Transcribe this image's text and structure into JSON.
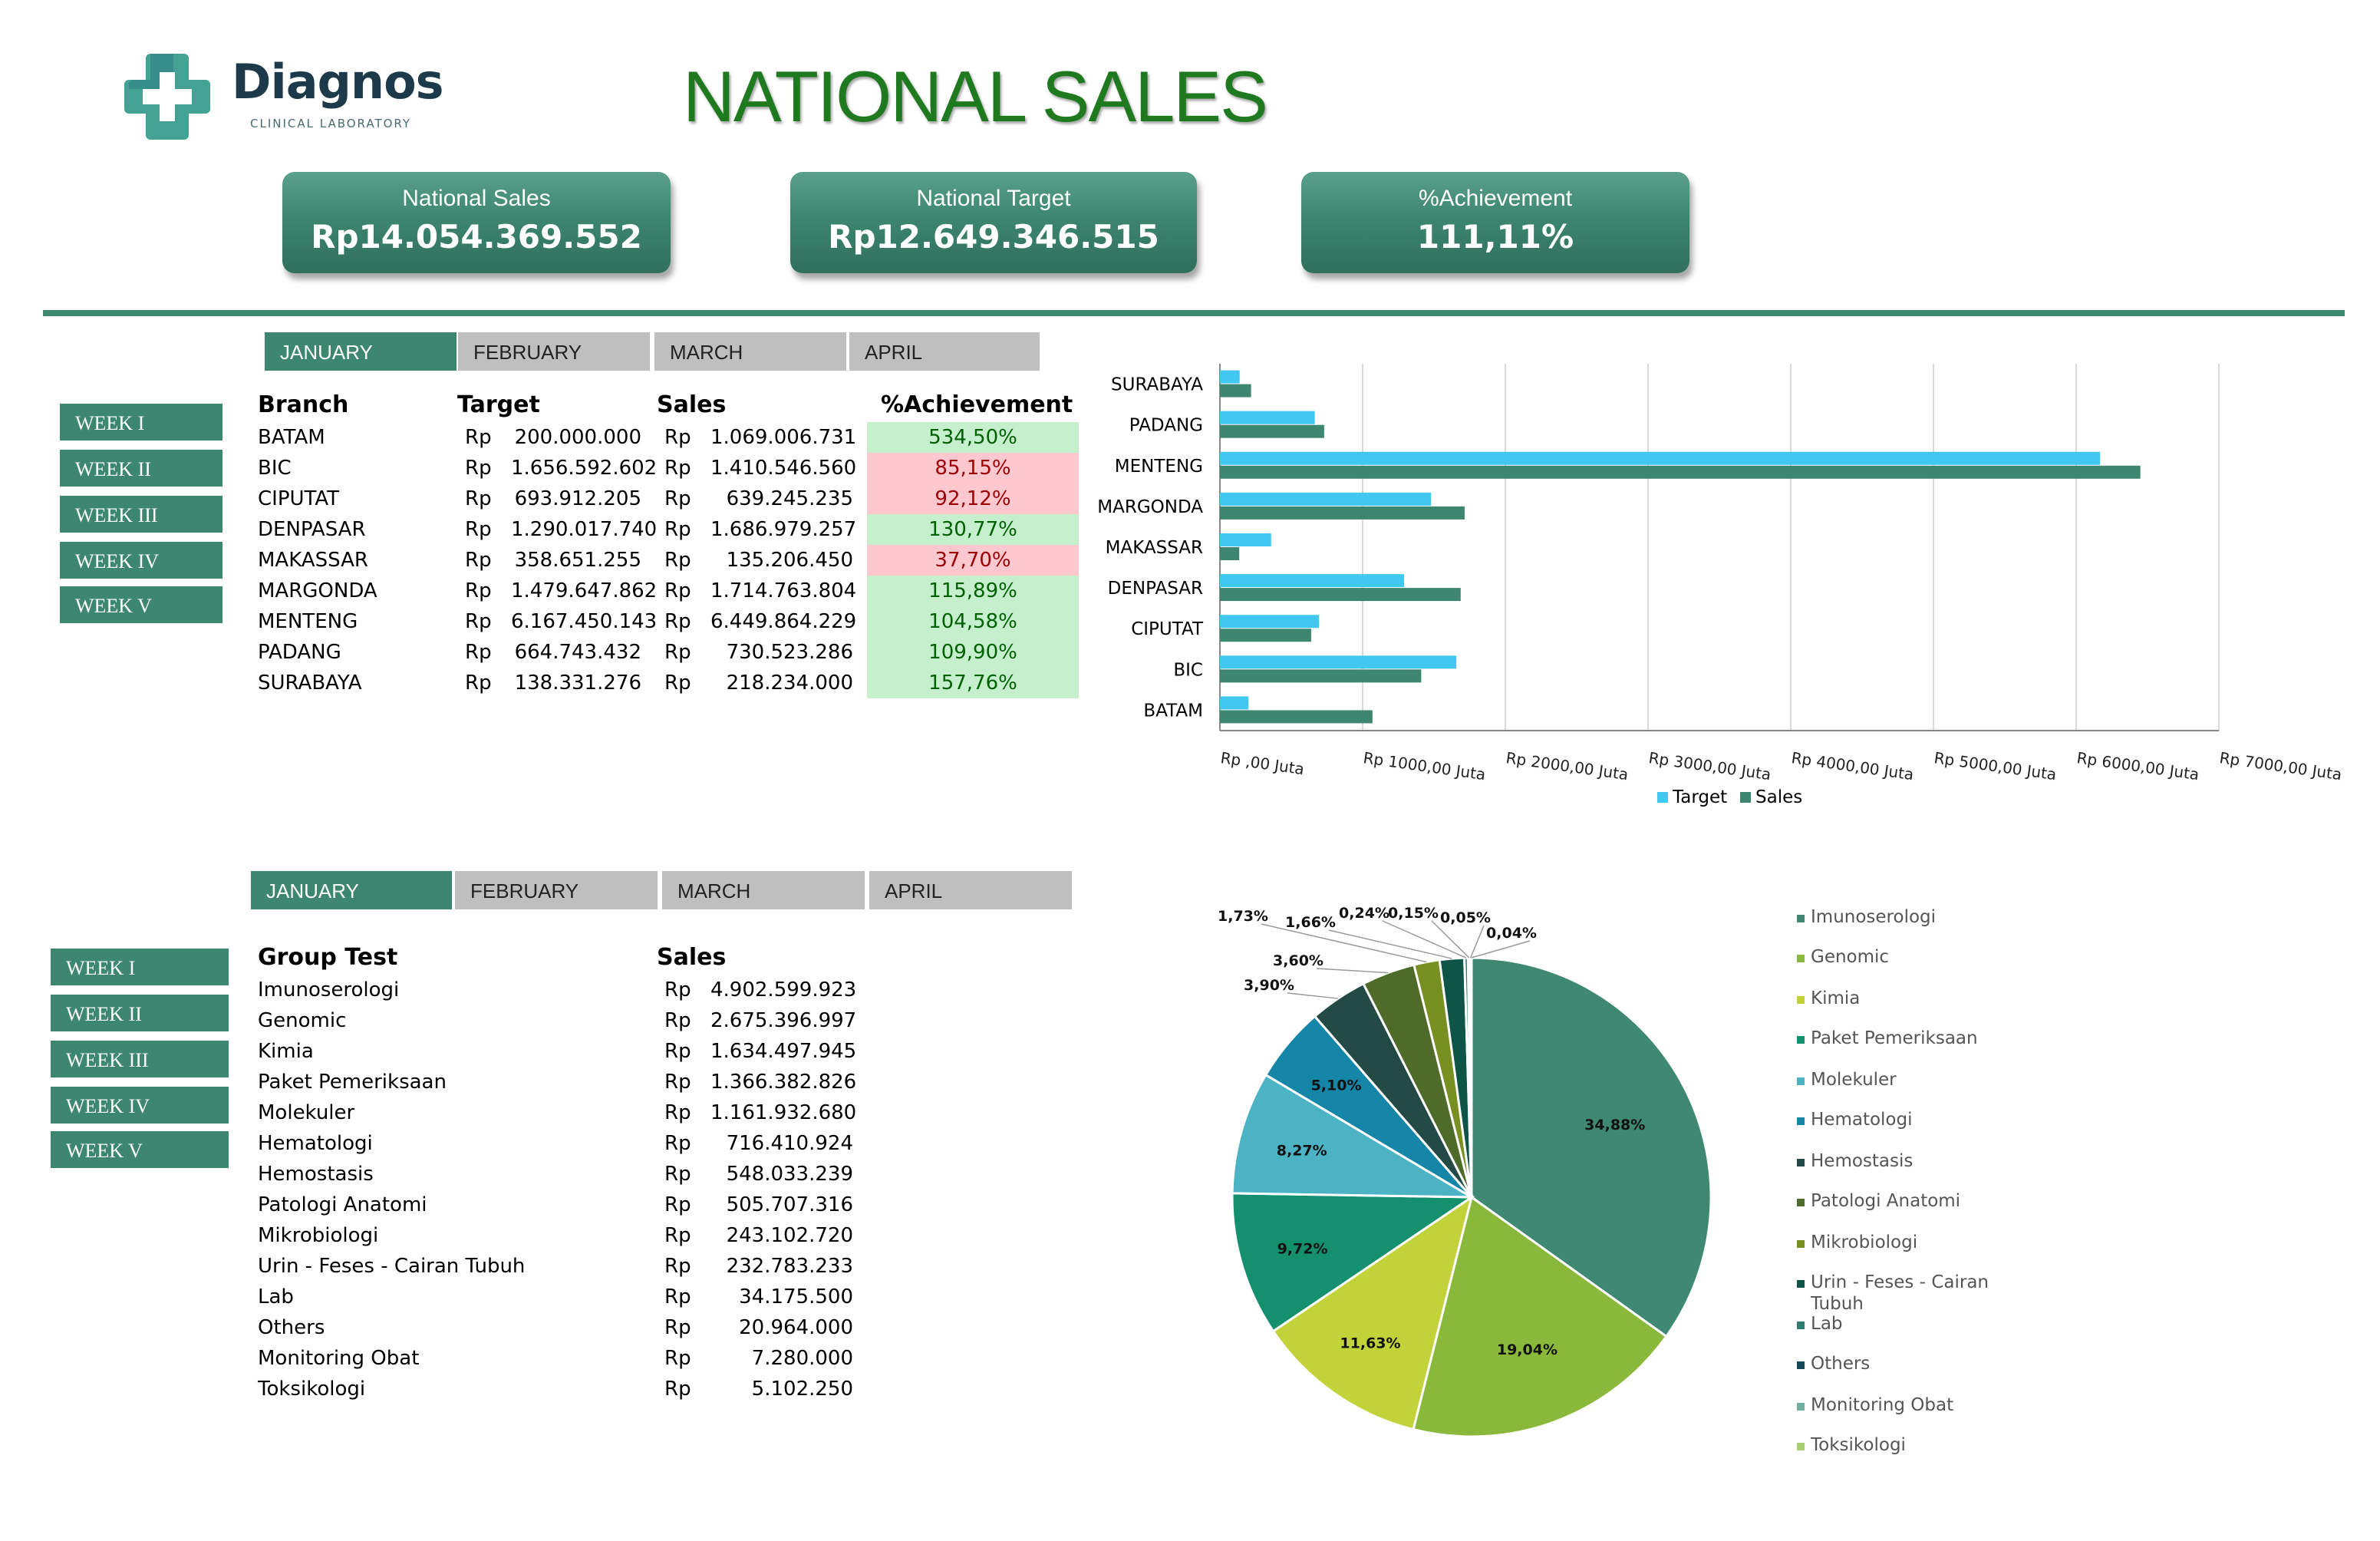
{
  "brand": {
    "name": "Diagnos",
    "subtitle": "CLINICAL LABORATORY"
  },
  "page_title": "NATIONAL SALES",
  "kpis": [
    {
      "label": "National Sales",
      "value": "Rp14.054.369.552"
    },
    {
      "label": "National Target",
      "value": "Rp12.649.346.515"
    },
    {
      "label": "%Achievement",
      "value": "111,11%"
    }
  ],
  "months": [
    "JANUARY",
    "FEBRUARY",
    "MARCH",
    "APRIL"
  ],
  "selected_month": "JANUARY",
  "weeks": [
    "WEEK I",
    "WEEK II",
    "WEEK III",
    "WEEK IV",
    "WEEK V"
  ],
  "branch_table": {
    "headers": {
      "branch": "Branch",
      "target": "Target",
      "sales": "Sales",
      "achievement": "%Achievement"
    },
    "currency": "Rp",
    "rows": [
      {
        "branch": "BATAM",
        "target": "200.000.000",
        "sales": "1.069.006.731",
        "achievement": "534,50%",
        "status": "good"
      },
      {
        "branch": "BIC",
        "target": "1.656.592.602",
        "sales": "1.410.546.560",
        "achievement": "85,15%",
        "status": "bad"
      },
      {
        "branch": "CIPUTAT",
        "target": "693.912.205",
        "sales": "639.245.235",
        "achievement": "92,12%",
        "status": "bad"
      },
      {
        "branch": "DENPASAR",
        "target": "1.290.017.740",
        "sales": "1.686.979.257",
        "achievement": "130,77%",
        "status": "good"
      },
      {
        "branch": "MAKASSAR",
        "target": "358.651.255",
        "sales": "135.206.450",
        "achievement": "37,70%",
        "status": "bad"
      },
      {
        "branch": "MARGONDA",
        "target": "1.479.647.862",
        "sales": "1.714.763.804",
        "achievement": "115,89%",
        "status": "good"
      },
      {
        "branch": "MENTENG",
        "target": "6.167.450.143",
        "sales": "6.449.864.229",
        "achievement": "104,58%",
        "status": "good"
      },
      {
        "branch": "PADANG",
        "target": "664.743.432",
        "sales": "730.523.286",
        "achievement": "109,90%",
        "status": "good"
      },
      {
        "branch": "SURABAYA",
        "target": "138.331.276",
        "sales": "218.234.000",
        "achievement": "157,76%",
        "status": "good"
      }
    ]
  },
  "group_table": {
    "headers": {
      "group": "Group Test",
      "sales": "Sales"
    },
    "currency": "Rp",
    "rows": [
      {
        "group": "Imunoserologi",
        "sales": "4.902.599.923"
      },
      {
        "group": "Genomic",
        "sales": "2.675.396.997"
      },
      {
        "group": "Kimia",
        "sales": "1.634.497.945"
      },
      {
        "group": "Paket Pemeriksaan",
        "sales": "1.366.382.826"
      },
      {
        "group": "Molekuler",
        "sales": "1.161.932.680"
      },
      {
        "group": "Hematologi",
        "sales": "716.410.924"
      },
      {
        "group": "Hemostasis",
        "sales": "548.033.239"
      },
      {
        "group": "Patologi Anatomi",
        "sales": "505.707.316"
      },
      {
        "group": "Mikrobiologi",
        "sales": "243.102.720"
      },
      {
        "group": "Urin - Feses - Cairan Tubuh",
        "sales": "232.783.233"
      },
      {
        "group": "Lab",
        "sales": "34.175.500"
      },
      {
        "group": "Others",
        "sales": "20.964.000"
      },
      {
        "group": "Monitoring Obat",
        "sales": "7.280.000"
      },
      {
        "group": "Toksikologi",
        "sales": "5.102.250"
      }
    ]
  },
  "colors": {
    "accent": "#3d8670",
    "target": "#41c8f0",
    "sales": "#3d8670",
    "title": "#1f7a1f"
  },
  "chart_data": [
    {
      "type": "bar",
      "orientation": "horizontal",
      "categories": [
        "SURABAYA",
        "PADANG",
        "MENTENG",
        "MARGONDA",
        "MAKASSAR",
        "DENPASAR",
        "CIPUTAT",
        "BIC",
        "BATAM"
      ],
      "series": [
        {
          "name": "Target",
          "color": "#41c8f0",
          "values": [
            138.33,
            664.74,
            6167.45,
            1479.65,
            358.65,
            1290.02,
            693.91,
            1656.59,
            200.0
          ]
        },
        {
          "name": "Sales",
          "color": "#3d8670",
          "values": [
            218.23,
            730.52,
            6449.86,
            1714.76,
            135.21,
            1686.98,
            639.25,
            1410.55,
            1069.01
          ]
        }
      ],
      "xlim": [
        0,
        7000
      ],
      "x_ticks": [
        "Rp ,00 Juta",
        "Rp 1000,00 Juta",
        "Rp 2000,00 Juta",
        "Rp 3000,00 Juta",
        "Rp 4000,00 Juta",
        "Rp 5000,00 Juta",
        "Rp 6000,00 Juta",
        "Rp 7000,00 Juta"
      ],
      "grid": true,
      "legend": "bottom"
    },
    {
      "type": "pie",
      "categories": [
        "Imunoserologi",
        "Genomic",
        "Kimia",
        "Paket Pemeriksaan",
        "Molekuler",
        "Hematologi",
        "Hemostasis",
        "Patologi Anatomi",
        "Mikrobiologi",
        "Urin - Feses - Cairan Tubuh",
        "Lab",
        "Others",
        "Monitoring Obat",
        "Toksikologi"
      ],
      "values": [
        34.88,
        19.04,
        11.63,
        9.72,
        8.27,
        5.1,
        3.9,
        3.6,
        1.73,
        1.66,
        0.24,
        0.15,
        0.05,
        0.04
      ],
      "labels": [
        "34,88%",
        "19,04%",
        "11,63%",
        "9,72%",
        "8,27%",
        "5,10%",
        "3,90%",
        "3,60%",
        "1,73%",
        "1,66%",
        "0,24%",
        "0,15%",
        "0,05%",
        "0,04%"
      ],
      "colors": [
        "#3f8872",
        "#8ab83a",
        "#c2d33a",
        "#14906f",
        "#4bb3c4",
        "#1686a8",
        "#234a45",
        "#4e6b2a",
        "#788f22",
        "#0e5548",
        "#2e7d6e",
        "#14495a",
        "#6fb09e",
        "#a8cf6e"
      ],
      "legend": "right"
    }
  ]
}
